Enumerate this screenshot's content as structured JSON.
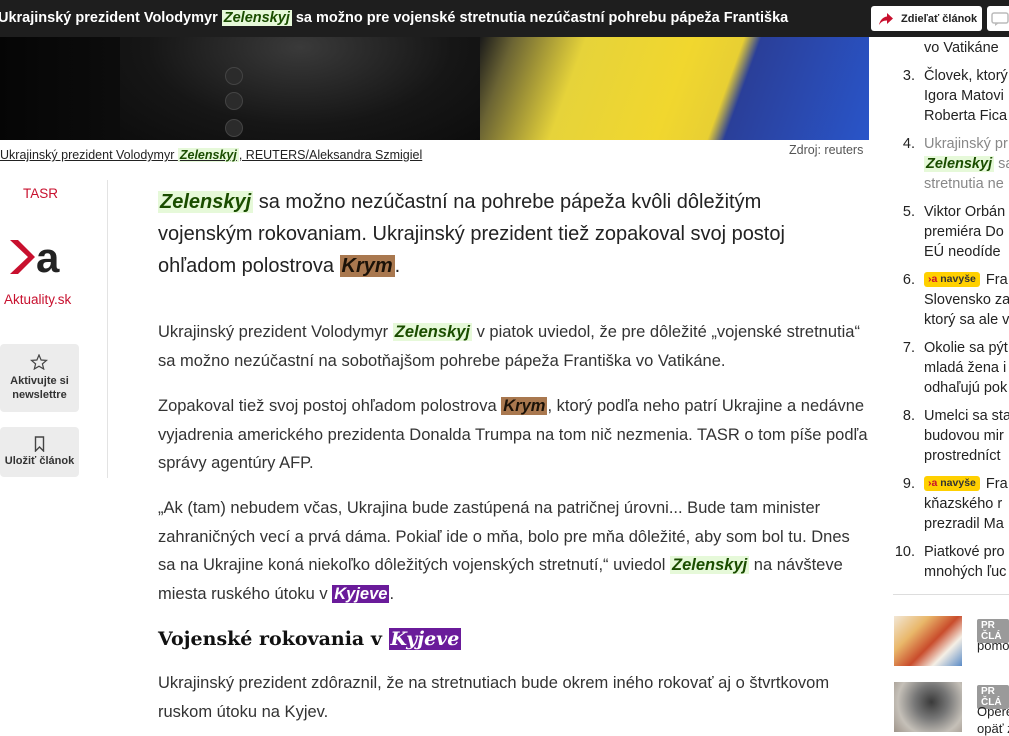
{
  "topbar": {
    "title_pre": "Ukrajinský prezident Volodymyr ",
    "title_kw": "Zelenskyj",
    "title_post": " sa možno pre vojenské stretnutia nezúčastní pohrebu pápeža Františka",
    "share_label": "Zdieľať článok",
    "share_icon": "share-arrow-icon",
    "comment_icon": "comment-icon"
  },
  "photo": {
    "caption_pre": "Ukrajinský prezident Volodymyr ",
    "caption_kw": "Zelenskyj",
    "caption_post": ", REUTERS/Aleksandra Szmigiel",
    "source": "Zdroj: reuters"
  },
  "meta": {
    "agency": "TASR",
    "site_name": "Aktuality.sk",
    "newsletter_label_1": "Aktivujte si",
    "newsletter_label_2": "newslettre",
    "newsletter_icon": "star-icon",
    "save_label": "Uložiť článok",
    "save_icon": "bookmark-icon"
  },
  "article": {
    "perex": {
      "kw1": "Zelenskyj",
      "t1": " sa možno nezúčastní na pohrebe pápeža kvôli dôležitým vojenským rokovaniam. Ukrajinský prezident tiež zopakoval svoj postoj ohľadom polostrova ",
      "kw2": "Krym",
      "t2": "."
    },
    "p1": {
      "t1": "Ukrajinský prezident Volodymyr ",
      "kw": "Zelenskyj",
      "t2": " v piatok uviedol, že pre dôležité „vojenské stretnutia“ sa možno nezúčastní na sobotňajšom pohrebe pápeža Františka vo Vatikáne."
    },
    "p2": {
      "t1": "Zopakoval tiež svoj postoj ohľadom polostrova ",
      "kw": "Krym",
      "t2": ", ktorý podľa neho patrí Ukrajine a nedávne vyjadrenia amerického prezidenta Donalda Trumpa na tom nič nezmenia. TASR o tom píše podľa správy agentúry AFP."
    },
    "p3": {
      "t1": "„Ak (tam) nebudem včas, Ukrajina bude zastúpená na patričnej úrovni... Bude tam minister zahraničných vecí a prvá dáma. Pokiaľ ide o mňa, bolo pre mňa dôležité, aby som bol tu. Dnes sa na Ukrajine koná niekoľko dôležitých vojenských stretnutí,“ uviedol ",
      "kw1": "Zelenskyj",
      "t2": " na návšteve miesta ruského útoku v ",
      "kw2": "Kyjeve",
      "t3": "."
    },
    "h2": {
      "t1": "Vojenské rokovania v ",
      "kw": "Kyjeve"
    },
    "p5": "Ukrajinský prezident zdôraznil, že na stretnutiach bude okrem iného rokovať aj o štvrtkovom ruskom útoku na Kyjev."
  },
  "sidebar": {
    "top_fragment": "vo Vatikáne",
    "items": [
      {
        "num": "3.",
        "lines": [
          "Človek, ktorý",
          "Igora Matovi",
          "Roberta Fica"
        ]
      },
      {
        "num": "4.",
        "lines": [
          "Ukrajinský pr",
          "sa",
          "stretnutia ne"
        ],
        "kw": "Zelenskyj"
      },
      {
        "num": "5.",
        "lines": [
          "Viktor Orbán",
          "premiéra Do",
          "EÚ neodíde"
        ]
      },
      {
        "num": "6.",
        "badge": "navyše",
        "lines": [
          "Fra",
          "Slovensko za",
          "ktorý sa ale v"
        ]
      },
      {
        "num": "7.",
        "lines": [
          "Okolie sa pýt",
          "mladá žena i",
          "odhaľujú pok"
        ]
      },
      {
        "num": "8.",
        "lines": [
          "Umelci sa sta",
          "budovou mir",
          "prostredníct"
        ]
      },
      {
        "num": "9.",
        "badge": "navyše",
        "lines": [
          "Fra",
          "kňazského r",
          "prezradil Ma"
        ]
      },
      {
        "num": "10.",
        "lines": [
          "Piatkové pro",
          "mnohých ľuc"
        ]
      }
    ],
    "badge_mark": "›a",
    "pr": [
      {
        "tag": "PR ČLÁ",
        "text": "pomo"
      },
      {
        "tag": "PR ČLÁ",
        "text_1": "Opere",
        "text_2": "opäť z"
      }
    ]
  }
}
